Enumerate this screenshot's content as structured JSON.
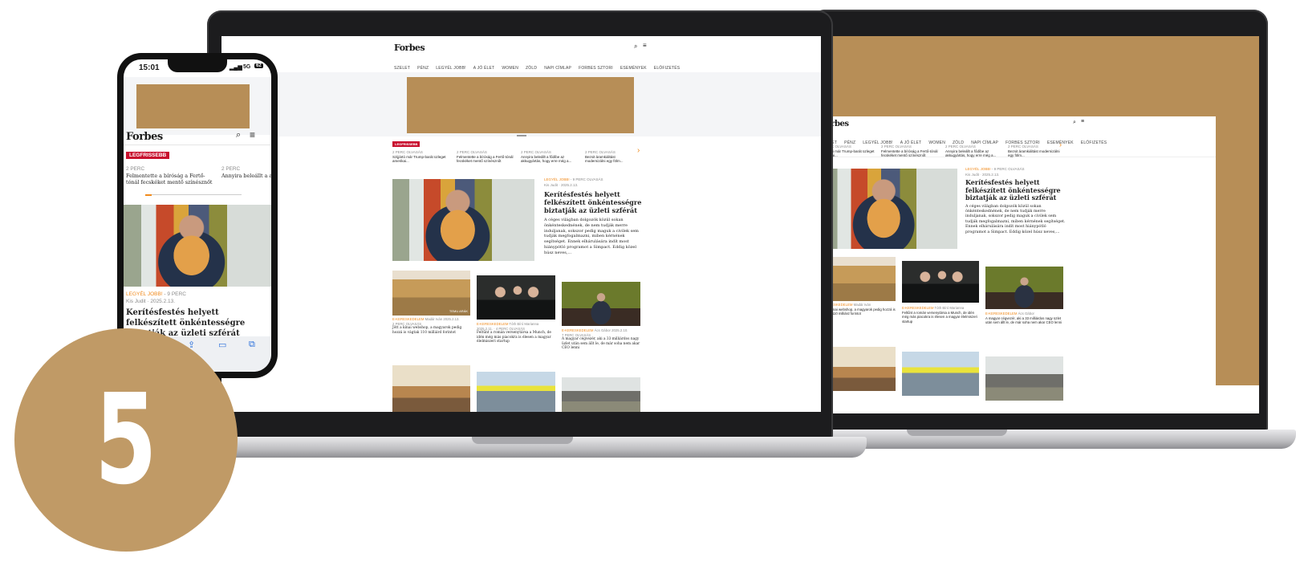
{
  "site": {
    "logo": "Forbes",
    "nav": [
      "SZELET",
      "PÉNZ",
      "LEGYÉL JOBB!",
      "A JÓ ÉLET",
      "WOMEN",
      "ZÖLD",
      "NAPI CÍMLAP",
      "FORBES SZTORI",
      "ESEMÉNYEK",
      "ELŐFIZETÉS"
    ],
    "latest_tag": "LEGFRISSEBB",
    "latest_items": [
      {
        "meta": "2 PERC OLVASÁS",
        "title": "Szijjártó már Trump-barát üzleget amerikai..."
      },
      {
        "meta": "2 PERC OLVASÁS",
        "title": "Felmentette a bíróság a Fertő-tónál fecskéket mentő színésznőt"
      },
      {
        "meta": "2 PERC OLVASÁS",
        "title": "Annyira beleállt a fődíbe az akkugyártás, hogy erre még a..."
      },
      {
        "meta": "2 PERC OLVASÁS",
        "title": "Bezsit áramkiáltást modernizálni egy fölm..."
      }
    ],
    "lead": {
      "kicker": "LEGYÉL JOBB!",
      "read_time": "9 PERC OLVASÁS",
      "author_date": "Kis Judit · 2025.2.13.",
      "title": "Kerítésfestés helyett felkészített önkéntességre biztatják az üzleti szférát",
      "excerpt": "A céges világban dolgozók közül sokan önkénteskednének, de nem tudják merre induljanak, sokszor pedig maguk a civilek sem tudják megfogalmazni, miben kérnének segítséget. Ennek elhárulására indít most hiánypótló programot a Simpact. Eddig közel húsz neves,..."
    },
    "articles": [
      {
        "kicker": "E-KERESKEDELEM",
        "author": "Madár Iván",
        "date": "2025.2.13.",
        "read": "2 PERC OLVASÁS",
        "title": "Jött a kínai webshop, a magyarok pedig hozzá is vágtak 110 milliárd forintot",
        "photo_label": "TEMU ARÁK"
      },
      {
        "kicker": "E-KERESKEDELEM",
        "author": "Tóth Bíró Marianna",
        "date": "2025.2.11.",
        "read": "4 PERC OLVASÁS",
        "title": "Feltűnt a román versenytársa a Munch, de idén még más piacokra is élesen a magyar élelmiszeri startup",
        "photo_label": ""
      },
      {
        "kicker": "E-KERESKEDELEM",
        "author": "Ács Gábor",
        "date": "2025.2.10.",
        "read": "7 PERC OLVASÁS",
        "title": "A magyar cégvezér, aki a 33 milliárdos nagy üzlet után sem állt le, de már soha nem akar CEO lenni",
        "photo_label": ""
      }
    ]
  },
  "phone": {
    "time": "15:01",
    "signal": "5G",
    "battery": "62",
    "logo": "Forbes",
    "latest_tag": "LEGFRISSEBB",
    "latest_items": [
      {
        "meta": "2 PERC",
        "title": "Felmentette a bíróság a Fertő-tónál fecskéket mentő színésznőt"
      },
      {
        "meta": "2 PERC",
        "title": "Annyira beleállt a akkugyártás, hogy"
      }
    ],
    "lead": {
      "kicker": "LEGYÉL JOBB!",
      "read_time": "9 PERC",
      "author_date": "Kis Judit · 2025.2.13.",
      "title": "Kerítésfestés helyett felkészített önkéntességre biztatják az üzleti szférát"
    }
  },
  "badge_number": "5",
  "colors": {
    "gold": "#b78e57",
    "badge": "#c09a66",
    "red_tag": "#c8102e",
    "kicker": "#f08a1c"
  }
}
